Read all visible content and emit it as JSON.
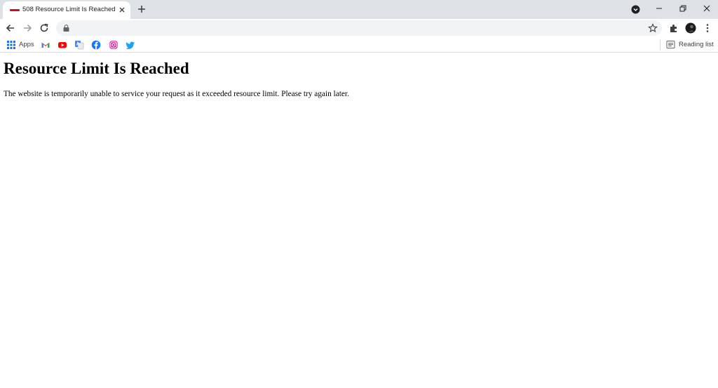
{
  "browser": {
    "tab": {
      "title": "508 Resource Limit Is Reached",
      "favicon": "red-logo-favicon"
    },
    "bookmarks": {
      "apps_label": "Apps",
      "items": [
        "gmail-icon",
        "youtube-icon",
        "google-translate-icon",
        "facebook-icon",
        "instagram-icon",
        "twitter-icon"
      ],
      "reading_list_label": "Reading list"
    },
    "colors": {
      "tabstrip": "#dee1e6",
      "omnibox": "#f1f3f4",
      "youtube": "#ff0000",
      "facebook": "#1877f2",
      "twitter": "#1da1f2"
    }
  },
  "page": {
    "heading": "Resource Limit Is Reached",
    "message": "The website is temporarily unable to service your request as it exceeded resource limit. Please try again later."
  }
}
